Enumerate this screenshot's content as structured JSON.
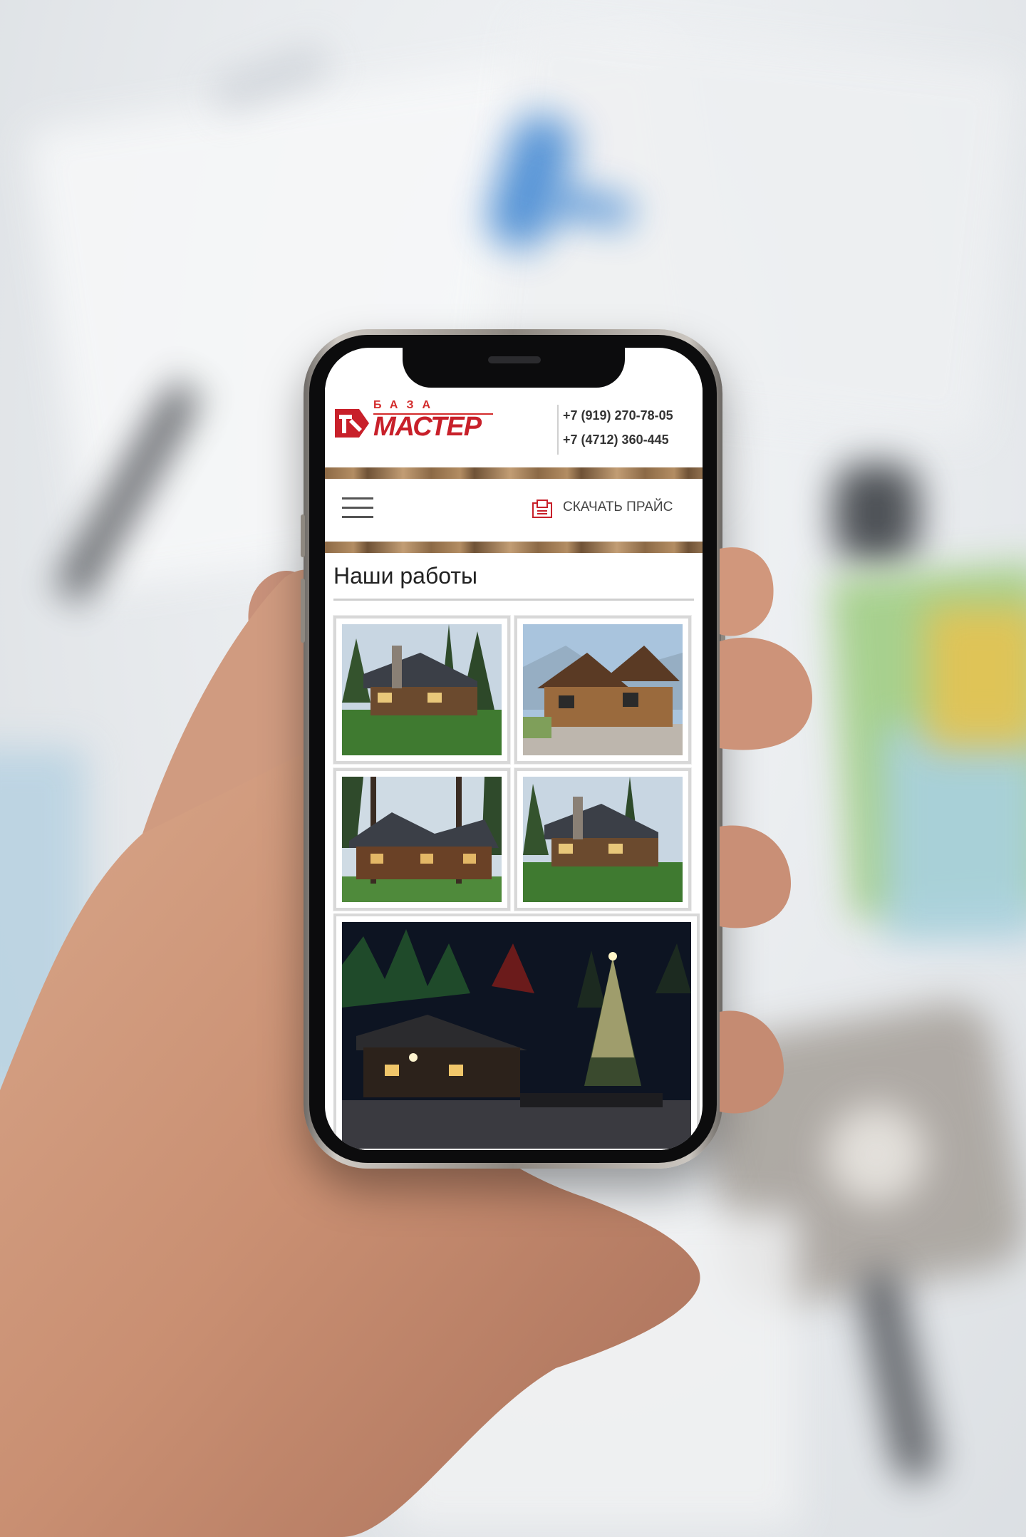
{
  "site": {
    "logo": {
      "top_word": "БАЗА",
      "main_word": "МАСТЕР"
    },
    "phones": [
      "+7 (919) 270-78-05",
      "+7 (4712) 360-445"
    ],
    "nav": {
      "menu_icon": "hamburger-icon",
      "price_icon": "document-icon",
      "price_label": "СКАЧАТЬ ПРАЙС"
    },
    "section_title": "Наши работы",
    "gallery": [
      {
        "scene": "log-house-day-forest"
      },
      {
        "scene": "timber-chalet-mountain"
      },
      {
        "scene": "log-house-pines"
      },
      {
        "scene": "log-house-day-forest"
      },
      {
        "scene": "log-house-night-christmas"
      }
    ]
  },
  "colors": {
    "brand_red": "#c8202a",
    "text_dark": "#222222",
    "rule_gray": "#cfcfcf",
    "wood_brown": "#8d6a46"
  }
}
